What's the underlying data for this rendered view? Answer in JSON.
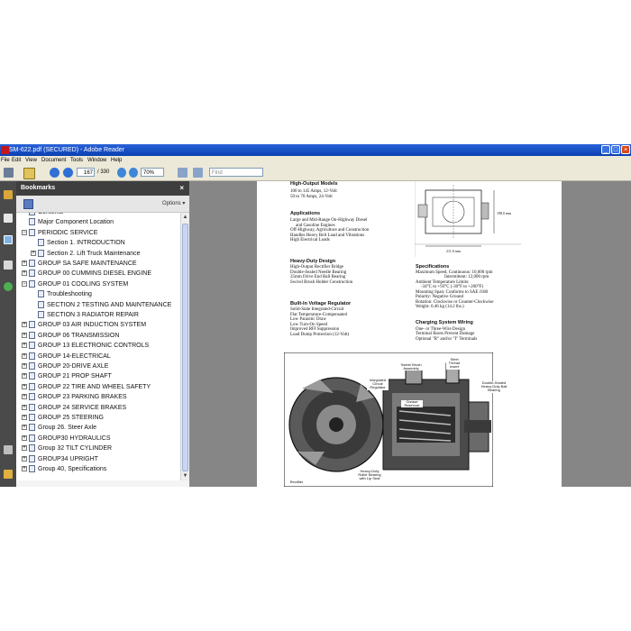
{
  "window": {
    "title": "SM-622.pdf (SECURED) - Adobe Reader",
    "controls": [
      "_",
      "□",
      "×"
    ]
  },
  "menu": [
    "File",
    "Edit",
    "View",
    "Document",
    "Tools",
    "Window",
    "Help"
  ],
  "toolbar": {
    "page_current": "167",
    "page_total": "/ 330",
    "zoom": "70%",
    "find_placeholder": "Find"
  },
  "bookmarks": {
    "title": "Bookmarks",
    "close": "×",
    "options_label": "Options ▾",
    "items": [
      {
        "label": "Contents",
        "expander": "",
        "indent": 0
      },
      {
        "label": "Major Component Location",
        "expander": "",
        "indent": 0
      },
      {
        "label": "PERIODIC SERVICE",
        "expander": "−",
        "indent": 0
      },
      {
        "label": "Section 1. INTRODUCTION",
        "expander": "",
        "indent": 1
      },
      {
        "label": "Section 2. Lift Truck Maintenance",
        "expander": "+",
        "indent": 1
      },
      {
        "label": "GROUP SA SAFE MAINTENANCE",
        "expander": "+",
        "indent": 0
      },
      {
        "label": "GROUP 00 CUMMINS DIESEL ENGINE",
        "expander": "+",
        "indent": 0
      },
      {
        "label": "GROUP 01 COOLING SYSTEM",
        "expander": "−",
        "indent": 0
      },
      {
        "label": "Troubleshooting",
        "expander": "",
        "indent": 1
      },
      {
        "label": "SECTION 2 TESTING AND MAINTENANCE",
        "expander": "",
        "indent": 1
      },
      {
        "label": "SECTION 3 RADIATOR REPAIR",
        "expander": "",
        "indent": 1
      },
      {
        "label": "GROUP 03 AIR INDUCTION SYSTEM",
        "expander": "+",
        "indent": 0
      },
      {
        "label": "GROUP 06 TRANSMISSION",
        "expander": "+",
        "indent": 0
      },
      {
        "label": "GROUP 13 ELECTRONIC CONTROLS",
        "expander": "+",
        "indent": 0
      },
      {
        "label": "GROUP 14-ELECTRICAL",
        "expander": "+",
        "indent": 0
      },
      {
        "label": "GROUP 20-DRIVE AXLE",
        "expander": "+",
        "indent": 0
      },
      {
        "label": "GROUP 21 PROP SHAFT",
        "expander": "+",
        "indent": 0
      },
      {
        "label": "GROUP 22 TIRE AND WHEEL SAFETY",
        "expander": "+",
        "indent": 0
      },
      {
        "label": "GROUP 23 PARKING BRAKES",
        "expander": "+",
        "indent": 0
      },
      {
        "label": "GROUP 24 SERVICE BRAKES",
        "expander": "+",
        "indent": 0
      },
      {
        "label": "GROUP 25 STEERING",
        "expander": "+",
        "indent": 0
      },
      {
        "label": "Group 26. Steer Axle",
        "expander": "+",
        "indent": 0
      },
      {
        "label": "GROUP30 HYDRAULICS",
        "expander": "+",
        "indent": 0
      },
      {
        "label": "Group 32 TILT CYLINDER",
        "expander": "+",
        "indent": 0
      },
      {
        "label": "GROUP34 UPRIGHT",
        "expander": "+",
        "indent": 0
      },
      {
        "label": "Group 40, Specifications",
        "expander": "+",
        "indent": 0
      }
    ]
  },
  "document": {
    "sections": [
      {
        "heading": "High-Output Models",
        "bullets": [
          "100 to 145 Amps, 12-Volt",
          "50 to 70 Amps, 24-Volt"
        ]
      },
      {
        "heading": "Applications",
        "bullets": [
          "Large and Mid-Range On-Highway Diesel",
          "and Gasoline Engines",
          "Off-Highway, Agriculture and Construction",
          "Handles Heavy Belt Load and Vibrations",
          "High Electrical Loads"
        ]
      },
      {
        "heading": "Heavy-Duty Design",
        "bullets": [
          "High-Output Rectifier Bridge",
          "Double-Sealed Needle Bearing",
          "25mm Drive End Ball Bearing",
          "Swivel Brush Holder Construction"
        ]
      },
      {
        "heading": "Built-In Voltage Regulator",
        "bullets": [
          "Solid-State Integrated-Circuit",
          "Flat Temperature-Compensated",
          "Low Parasitic Draw",
          "Low Turn-On Speed",
          "Improved RFI Suppression",
          "Load Dump Protection (12-Volt)"
        ]
      },
      {
        "heading": "Specifications",
        "bullets": [
          "Maximum Speed, Continuous: 10,000 rpm",
          "Intermittent: 12,000 rpm",
          "Ambient Temperature Limits:",
          "-34°C to +93°C (-30°F to +200°F)",
          "Mounting Span: Conforms to SAE J180",
          "Polarity: Negative Ground",
          "Rotation: Clockwise or Counter-Clockwise",
          "Weight: 6.46 kg (14.2 lbs.)"
        ]
      },
      {
        "heading": "Charging System Wiring",
        "bullets": [
          "One- or Three-Wire Design",
          "Terminal Boots Prevent Damage",
          "Optional \"R\" and/or \"I\" Terminals"
        ]
      }
    ],
    "drawing_dims": {
      "height": "198.0 mm",
      "width": "211.0 mm"
    },
    "callouts": {
      "brush": "Swivel Brush Assembly",
      "steel": "Steel Thread Insert",
      "regulator": "Integrated Circuit Regulator",
      "grease": "Grease Reservoir",
      "bearing": "Double-Sealed Heavy-Duty Ball Bearing",
      "roller": "Heavy-Duty Roller Bearing with Lip Seal",
      "rectifier": "Rectifier"
    }
  }
}
